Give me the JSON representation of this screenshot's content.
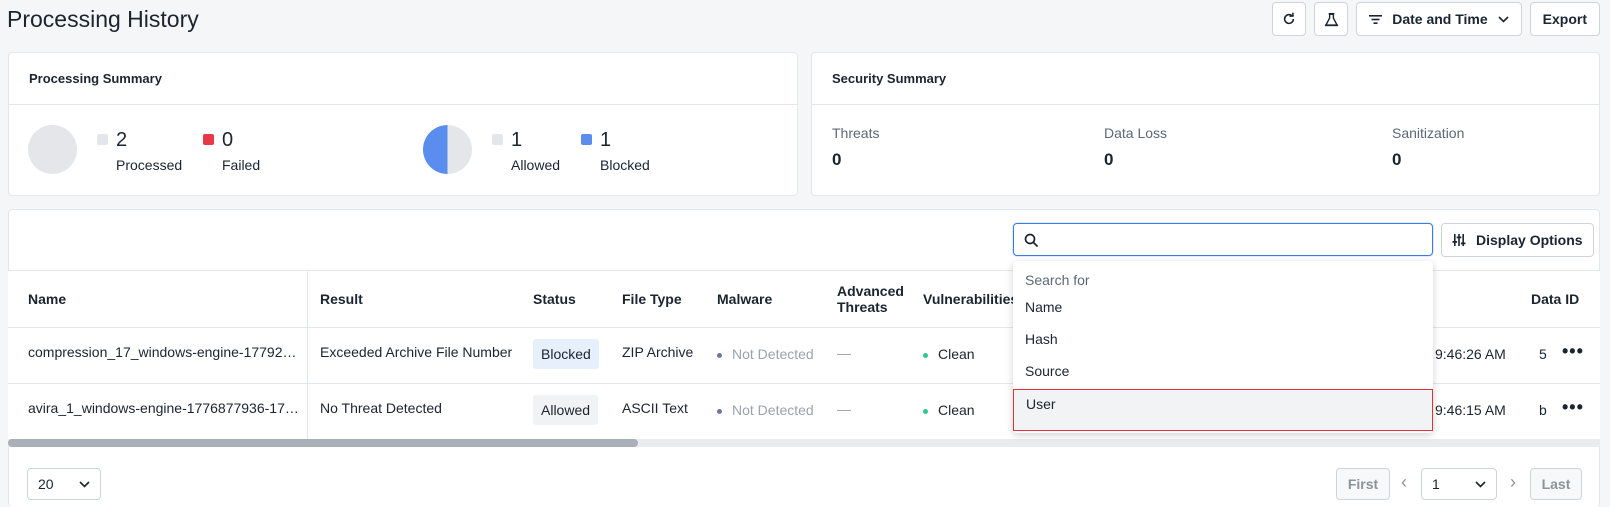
{
  "page": {
    "title": "Processing History"
  },
  "toolbar": {
    "refresh_icon": "refresh-icon",
    "flask_icon": "flask-icon",
    "date_filter_label": "Date and Time",
    "export_label": "Export"
  },
  "processing_summary": {
    "title": "Processing Summary",
    "processed": {
      "value": "2",
      "label": "Processed",
      "color": "#e4e6ea"
    },
    "failed": {
      "value": "0",
      "label": "Failed",
      "color": "#e8394b"
    },
    "allowed": {
      "value": "1",
      "label": "Allowed",
      "color": "#e4e6ea"
    },
    "blocked": {
      "value": "1",
      "label": "Blocked",
      "color": "#5b8def"
    }
  },
  "security_summary": {
    "title": "Security Summary",
    "threats": {
      "label": "Threats",
      "value": "0"
    },
    "data_loss": {
      "label": "Data Loss",
      "value": "0"
    },
    "sanitization": {
      "label": "Sanitization",
      "value": "0"
    }
  },
  "search": {
    "placeholder": "",
    "value": ""
  },
  "display_options_label": "Display Options",
  "table": {
    "columns": {
      "name": "Name",
      "result": "Result",
      "status": "Status",
      "file_type": "File Type",
      "malware": "Malware",
      "advanced_threats_line1": "Advanced",
      "advanced_threats_line2": "Threats",
      "vulnerabilities": "Vulnerabilities",
      "data_id": "Data ID"
    },
    "rows": [
      {
        "name": "compression_17_windows-engine-17792…",
        "result": "Exceeded Archive File Number",
        "status": "Blocked",
        "file_type": "ZIP Archive",
        "malware": "Not Detected",
        "advanced_threats": "—",
        "vulnerabilities": "Clean",
        "time": "9:46:26 AM",
        "data_id": "5",
        "actions": "•••"
      },
      {
        "name": "avira_1_windows-engine-1776877936-17…",
        "result": "No Threat Detected",
        "status": "Allowed",
        "file_type": "ASCII Text",
        "malware": "Not Detected",
        "advanced_threats": "—",
        "vulnerabilities": "Clean",
        "time": "9:46:15 AM",
        "data_id": "b",
        "actions": "•••"
      }
    ]
  },
  "search_dropdown": {
    "header": "Search for",
    "options": [
      "Name",
      "Hash",
      "Source",
      "User"
    ],
    "selected": "User"
  },
  "pagination": {
    "page_size": "20",
    "first_label": "First",
    "current_page": "1",
    "last_label": "Last",
    "prev_icon": "chevron-left-icon",
    "next_icon": "chevron-right-icon"
  },
  "colors": {
    "accent": "#3b7ce4",
    "selected_outline": "#e0313c",
    "clean_dot": "#2fc98a"
  }
}
